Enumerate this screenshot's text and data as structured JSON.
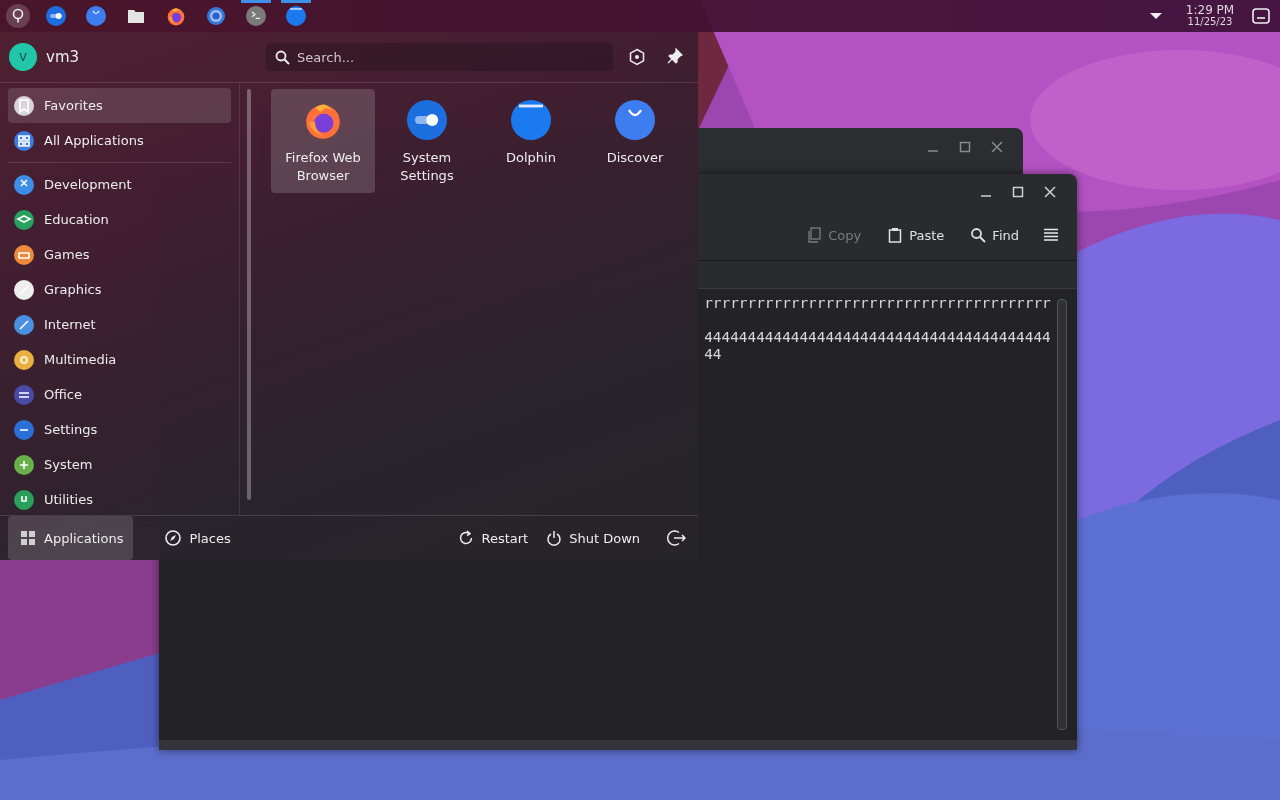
{
  "panel": {
    "tasks": [
      {
        "active": false
      },
      {
        "active": false
      },
      {
        "active": false
      },
      {
        "active": false
      },
      {
        "active": false
      },
      {
        "active": true
      },
      {
        "active": true
      }
    ],
    "clock": {
      "time": "1:29 PM",
      "date": "11/25/23"
    }
  },
  "launcher": {
    "user": {
      "initial": "V",
      "name": "vm3"
    },
    "search": {
      "placeholder": "Search..."
    },
    "places": [
      {
        "label": "Favorites",
        "selected": true,
        "color": "#d8d4d8"
      },
      {
        "label": "All Applications",
        "selected": false,
        "color": "#3a7be0"
      }
    ],
    "categories": [
      {
        "label": "Development",
        "selected": false,
        "color": "#3d8ee8"
      },
      {
        "label": "Education",
        "selected": false,
        "color": "#27a060"
      },
      {
        "label": "Games",
        "selected": false,
        "color": "#ee8a3c"
      },
      {
        "label": "Graphics",
        "selected": false,
        "color": "#eeeeee"
      },
      {
        "label": "Internet",
        "selected": false,
        "color": "#4a90e2"
      },
      {
        "label": "Multimedia",
        "selected": false,
        "color": "#e8b040"
      },
      {
        "label": "Office",
        "selected": false,
        "color": "#4a4aa8"
      },
      {
        "label": "Settings",
        "selected": false,
        "color": "#2a70d8"
      },
      {
        "label": "System",
        "selected": false,
        "color": "#6ab04a"
      },
      {
        "label": "Utilities",
        "selected": false,
        "color": "#2aa05a"
      }
    ],
    "apps": [
      {
        "label": "Firefox Web Browser",
        "selected": true
      },
      {
        "label": "System Settings",
        "selected": false
      },
      {
        "label": "Dolphin",
        "selected": false
      },
      {
        "label": "Discover",
        "selected": false
      }
    ],
    "tabs": [
      {
        "label": "Applications",
        "selected": true
      },
      {
        "label": "Places",
        "selected": false
      }
    ],
    "actions": [
      "Restart",
      "Shut Down"
    ]
  },
  "terminal": {
    "toolbar": [
      {
        "label": "Copy",
        "disabled": true
      },
      {
        "label": "Paste",
        "disabled": false
      },
      {
        "label": "Find",
        "disabled": false
      }
    ],
    "output": [
      [
        "rrrrrrrrrrrrrrrrrrrrrrrrrrrrrrrrrrrrrrrr"
      ],
      [
        "4444444444444444444444444444444444444444",
        "44"
      ]
    ]
  }
}
